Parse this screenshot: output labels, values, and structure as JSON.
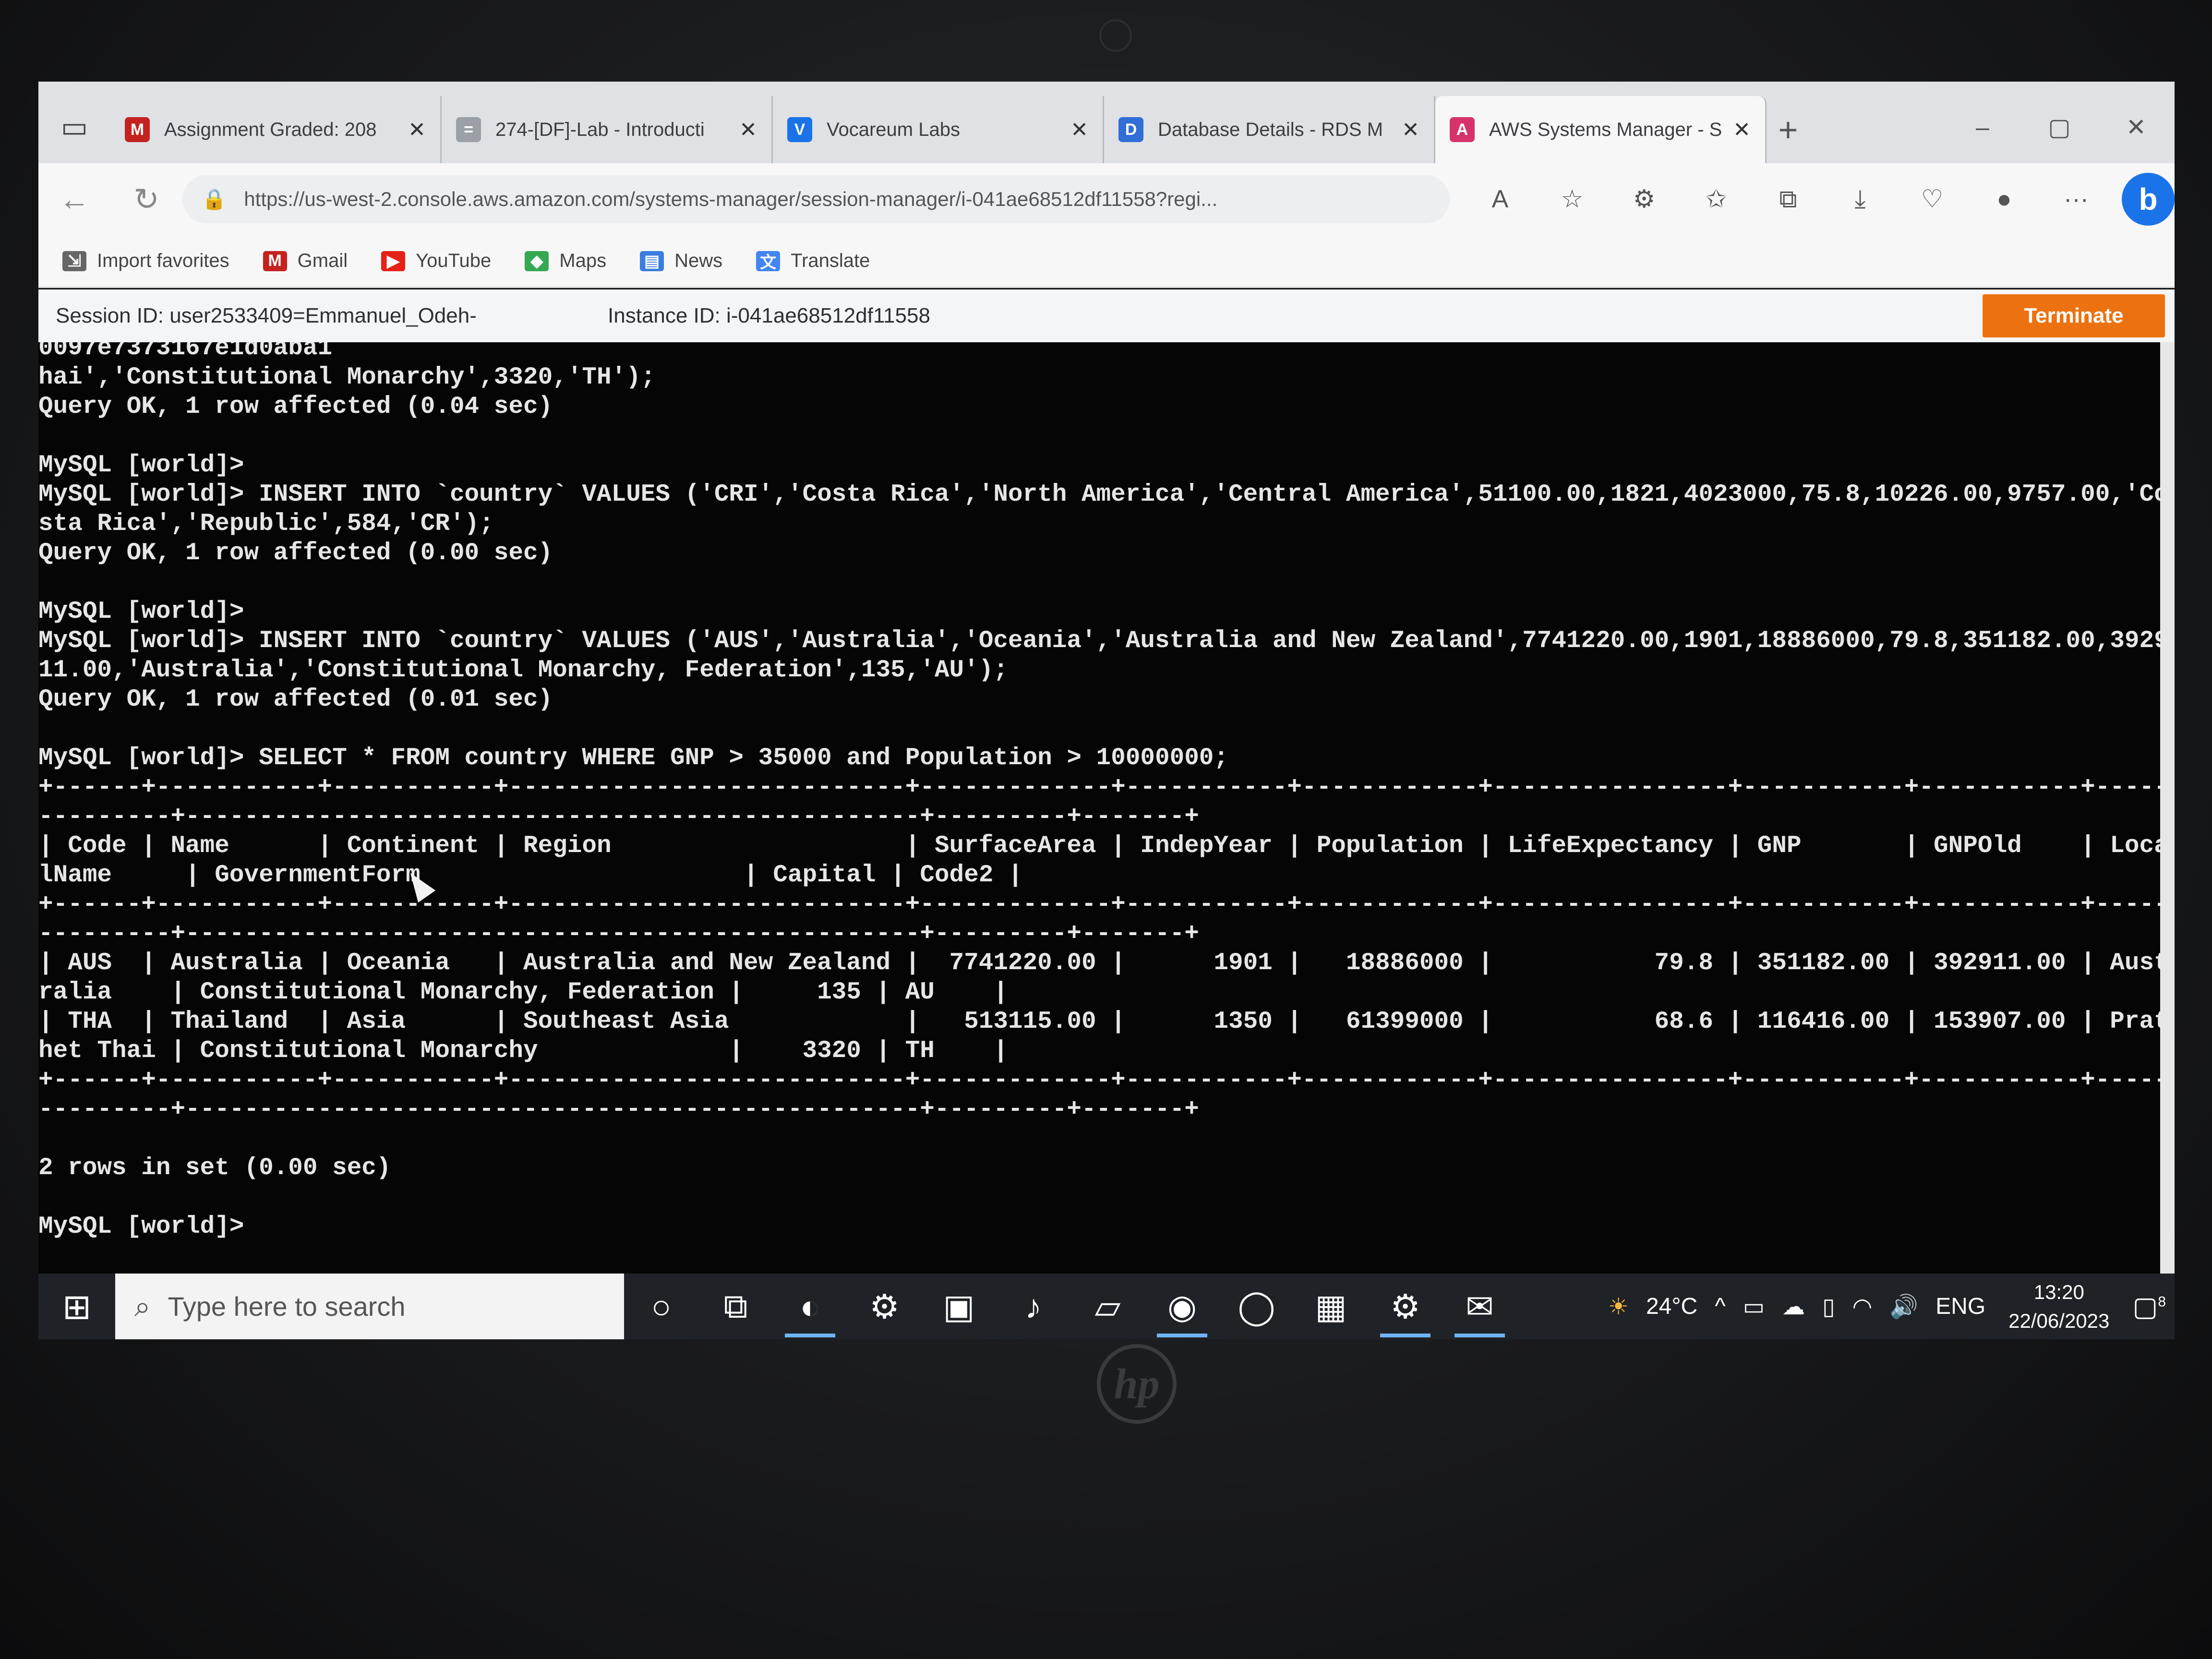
{
  "browser": {
    "tabs": [
      {
        "label": "Assignment Graded: 208",
        "icon": "gmail-icon",
        "color": "#c5221f",
        "glyph": "M",
        "active": false
      },
      {
        "label": "274-[DF]-Lab - Introducti",
        "icon": "doc-icon",
        "color": "#9aa0a6",
        "glyph": "=",
        "active": false
      },
      {
        "label": "Vocareum Labs",
        "icon": "vocareum-icon",
        "color": "#1a73e8",
        "glyph": "V",
        "active": false
      },
      {
        "label": "Database Details - RDS M",
        "icon": "rds-icon",
        "color": "#2f6fd6",
        "glyph": "D",
        "active": false
      },
      {
        "label": "AWS Systems Manager - S",
        "icon": "aws-icon",
        "color": "#d6336c",
        "glyph": "A",
        "active": true
      }
    ],
    "new_tab": "+",
    "url": "https://us-west-2.console.aws.amazon.com/systems-manager/session-manager/i-041ae68512df11558?regi...",
    "favorites": [
      {
        "label": "Import favorites",
        "icon": "import-icon",
        "color": "#666666",
        "glyph": "⇲"
      },
      {
        "label": "Gmail",
        "icon": "gmail-icon",
        "color": "#c5221f",
        "glyph": "M"
      },
      {
        "label": "YouTube",
        "icon": "youtube-icon",
        "color": "#e62117",
        "glyph": "▶"
      },
      {
        "label": "Maps",
        "icon": "maps-icon",
        "color": "#34a853",
        "glyph": "◆"
      },
      {
        "label": "News",
        "icon": "news-icon",
        "color": "#3b7de0",
        "glyph": "▤"
      },
      {
        "label": "Translate",
        "icon": "translate-icon",
        "color": "#4285f4",
        "glyph": "文"
      }
    ]
  },
  "session": {
    "session_id": "Session ID: user2533409=Emmanuel_Odeh-",
    "instance_id": "Instance ID: i-041ae68512df11558",
    "terminate_label": "Terminate"
  },
  "terminal": {
    "lines": [
      "0097e7373167e1d0aba1",
      "hai','Constitutional Monarchy',3320,'TH');",
      "Query OK, 1 row affected (0.04 sec)",
      "",
      "MySQL [world]>",
      "MySQL [world]> INSERT INTO `country` VALUES ('CRI','Costa Rica','North America','Central America',51100.00,1821,4023000,75.8,10226.00,9757.00,'Co",
      "sta Rica','Republic',584,'CR');",
      "Query OK, 1 row affected (0.00 sec)",
      "",
      "MySQL [world]>",
      "MySQL [world]> INSERT INTO `country` VALUES ('AUS','Australia','Oceania','Australia and New Zealand',7741220.00,1901,18886000,79.8,351182.00,3929",
      "11.00,'Australia','Constitutional Monarchy, Federation',135,'AU');",
      "Query OK, 1 row affected (0.01 sec)",
      "",
      "MySQL [world]> SELECT * FROM country WHERE GNP > 35000 and Population > 10000000;",
      "+------+-----------+-----------+---------------------------+-------------+-----------+------------+----------------+-----------+-----------+-----",
      "---------+--------------------------------------------------+---------+-------+",
      "| Code | Name      | Continent | Region                    | SurfaceArea | IndepYear | Population | LifeExpectancy | GNP       | GNPOld    | Loca",
      "lName     | GovernmentForm                      | Capital | Code2 |",
      "+------+-----------+-----------+---------------------------+-------------+-----------+------------+----------------+-----------+-----------+-----",
      "---------+--------------------------------------------------+---------+-------+",
      "| AUS  | Australia | Oceania   | Australia and New Zealand |  7741220.00 |      1901 |   18886000 |           79.8 | 351182.00 | 392911.00 | Aust",
      "ralia    | Constitutional Monarchy, Federation |     135 | AU    |",
      "| THA  | Thailand  | Asia      | Southeast Asia            |   513115.00 |      1350 |   61399000 |           68.6 | 116416.00 | 153907.00 | Prat",
      "het Thai | Constitutional Monarchy             |    3320 | TH    |",
      "+------+-----------+-----------+---------------------------+-------------+-----------+------------+----------------+-----------+-----------+-----",
      "---------+--------------------------------------------------+---------+-------+",
      "",
      "2 rows in set (0.00 sec)",
      "",
      "MySQL [world]>"
    ]
  },
  "taskbar": {
    "search_placeholder": "Type here to search",
    "apps": [
      {
        "name": "cortana-circle-icon",
        "glyph": "○",
        "active": false
      },
      {
        "name": "task-view-icon",
        "glyph": "⧉",
        "active": false
      },
      {
        "name": "edge-icon",
        "glyph": "◐",
        "active": true
      },
      {
        "name": "settings-gear-icon",
        "glyph": "⚙",
        "active": false
      },
      {
        "name": "calendar-app-icon",
        "glyph": "▣",
        "active": false
      },
      {
        "name": "tiktok-icon",
        "glyph": "♪",
        "active": false
      },
      {
        "name": "notes-icon",
        "glyph": "▱",
        "active": false
      },
      {
        "name": "chrome-icon",
        "glyph": "◉",
        "active": true
      },
      {
        "name": "cortana-ring-icon",
        "glyph": "◯",
        "active": false
      },
      {
        "name": "game-icon",
        "glyph": "▦",
        "active": false
      },
      {
        "name": "settings-icon",
        "glyph": "⚙",
        "active": true
      },
      {
        "name": "mail-icon",
        "glyph": "✉",
        "active": true
      }
    ],
    "weather": "24°C",
    "language": "ENG",
    "time": "13:20",
    "date": "22/06/2023",
    "notification_count": "8"
  },
  "laptop_brand": "hp"
}
